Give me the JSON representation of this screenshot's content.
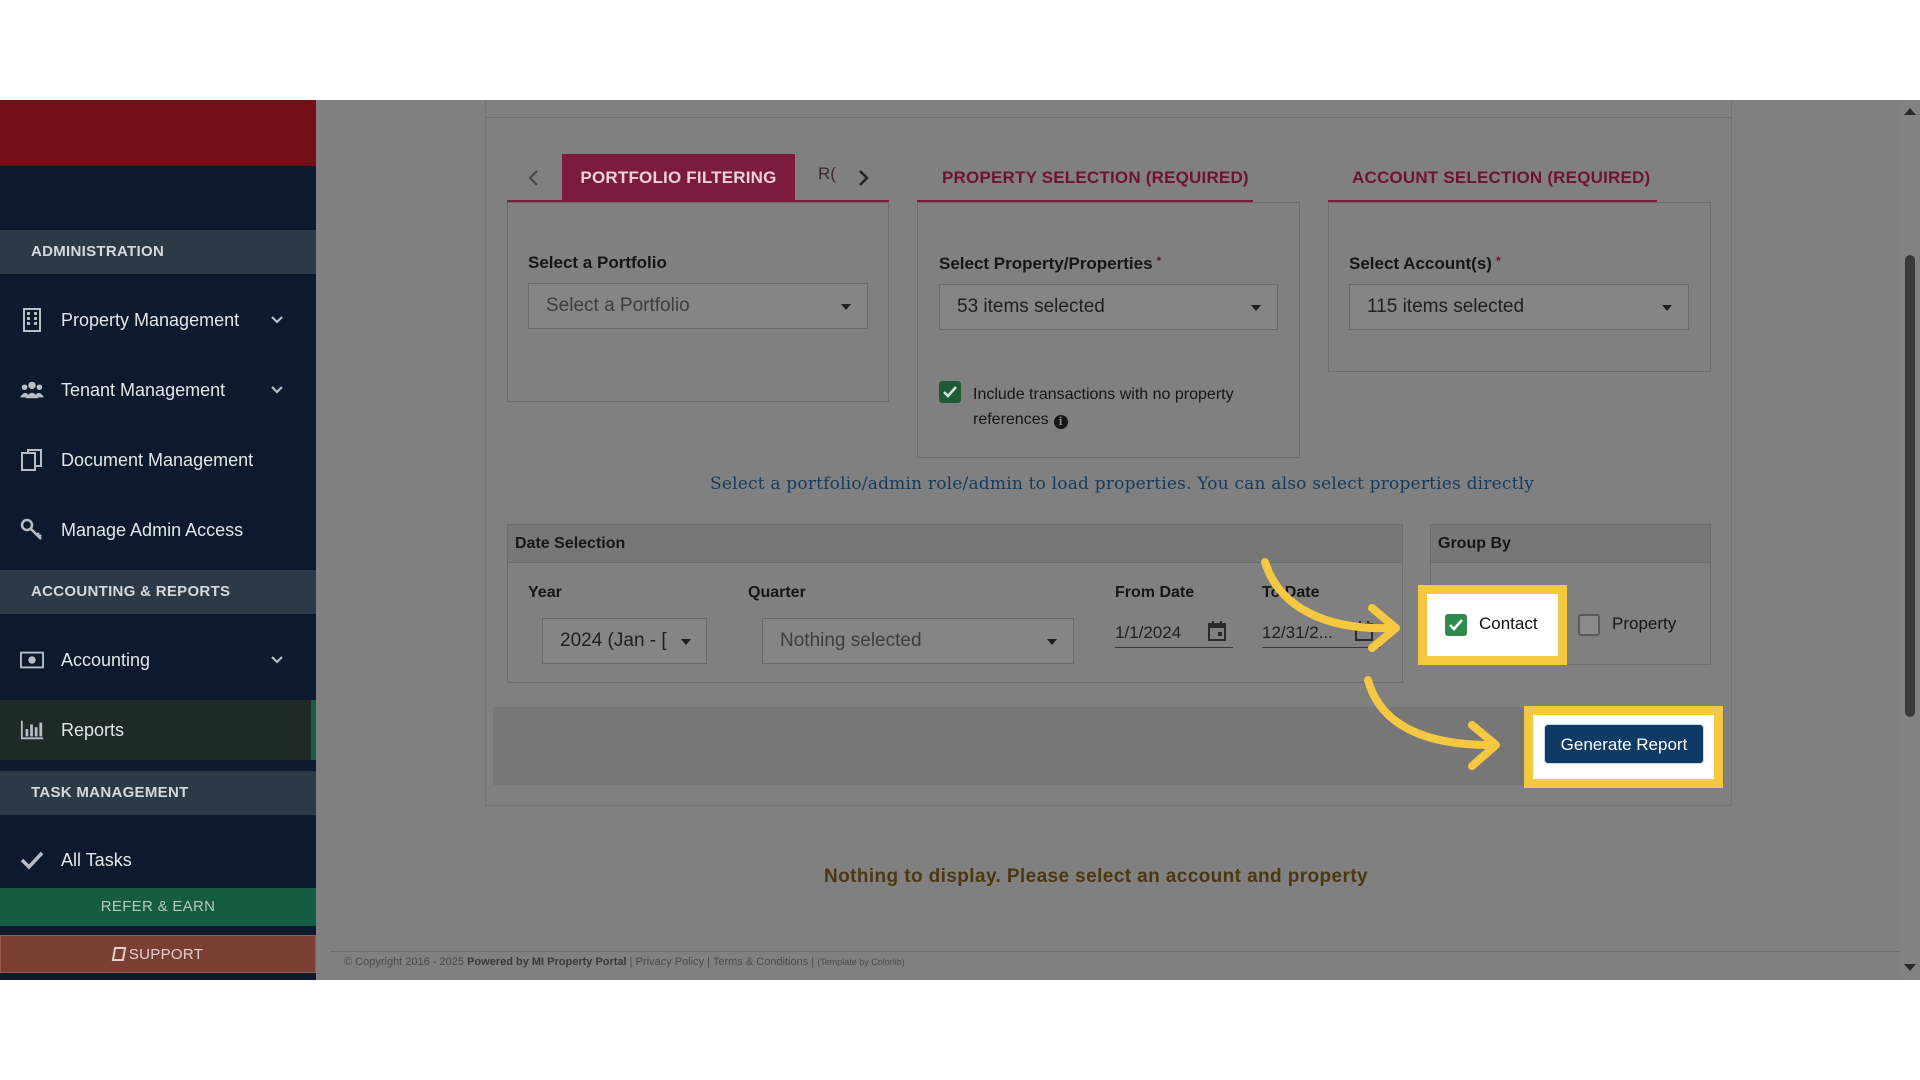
{
  "sidebar": {
    "brand_text": "",
    "sections": {
      "administration": "ADMINISTRATION",
      "accounting_reports": "ACCOUNTING & REPORTS",
      "task_management": "TASK MANAGEMENT"
    },
    "items": [
      {
        "label": "Property Management",
        "icon": "building-icon",
        "has_chevron": true
      },
      {
        "label": "Tenant Management",
        "icon": "users-icon",
        "has_chevron": true
      },
      {
        "label": "Document Management",
        "icon": "documents-icon",
        "has_chevron": false
      },
      {
        "label": "Manage Admin Access",
        "icon": "key-icon",
        "has_chevron": false
      },
      {
        "label": "Accounting",
        "icon": "money-icon",
        "has_chevron": true
      },
      {
        "label": "Reports",
        "icon": "bar-chart-icon",
        "has_chevron": false,
        "active": true
      },
      {
        "label": "All Tasks",
        "icon": "check-icon",
        "has_chevron": false
      }
    ],
    "refer_label": "REFER & EARN",
    "support_label": "SUPPORT"
  },
  "tabs": {
    "portfolio_filtering": "PORTFOLIO FILTERING",
    "next_tab_partial": "R(",
    "property_selection": "PROPERTY SELECTION (REQUIRED)",
    "account_selection": "ACCOUNT SELECTION (REQUIRED)"
  },
  "portfolio": {
    "label": "Select a Portfolio",
    "placeholder": "Select a Portfolio"
  },
  "property": {
    "label": "Select Property/Properties",
    "required_mark": "*",
    "value": "53 items selected",
    "include_no_property": {
      "checked": true,
      "line1": "Include transactions with no property",
      "line2": "references"
    }
  },
  "account": {
    "label": "Select Account(s)",
    "required_mark": "*",
    "value": "115 items selected"
  },
  "info_message": "Select a portfolio/admin role/admin to load properties. You can also select properties directly",
  "date_selection": {
    "title": "Date Selection",
    "year_label": "Year",
    "year_value": "2024 (Jan - [",
    "quarter_label": "Quarter",
    "quarter_value": "Nothing selected",
    "from_label": "From Date",
    "from_value": "1/1/2024",
    "to_label": "To Date",
    "to_value": "12/31/2..."
  },
  "group_by": {
    "title": "Group By",
    "contact_label": "Contact",
    "contact_checked": true,
    "property_label": "Property",
    "property_checked": false
  },
  "generate_button": "Generate Report",
  "nothing_message": "Nothing to display. Please select an account and property",
  "footer": {
    "copyright": "© Copyright 2016 - 2025",
    "powered_by": "Powered by MI Property Portal",
    "privacy": "Privacy Policy",
    "terms": "Terms & Conditions",
    "template": "(Template by Colorlib)"
  },
  "colors": {
    "highlight": "#f5c842",
    "accent": "#7d1b3e",
    "primary_button": "#0e3a66"
  }
}
